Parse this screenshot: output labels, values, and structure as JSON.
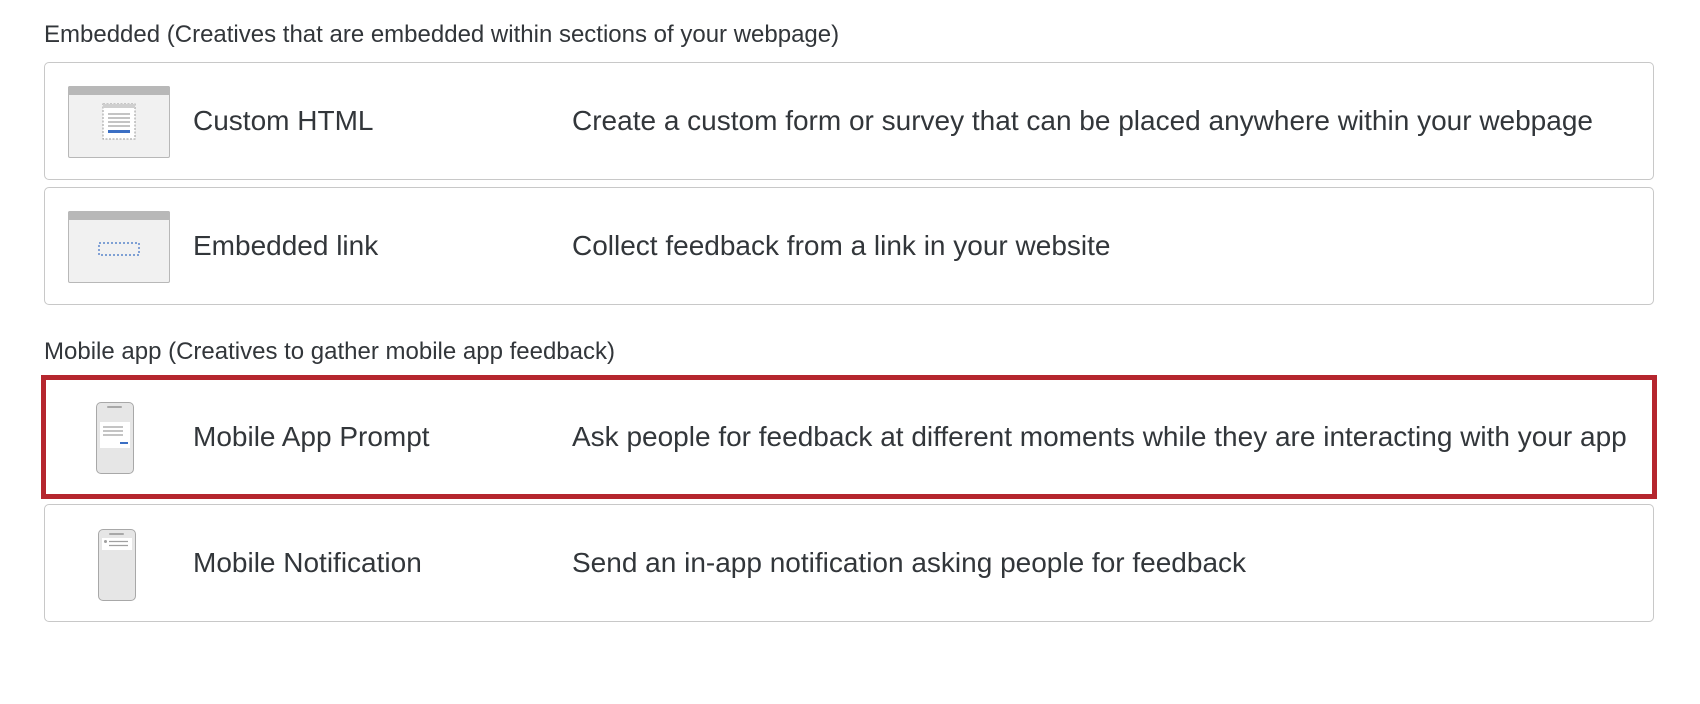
{
  "sections": {
    "embedded": {
      "heading": "Embedded (Creatives that are embedded within sections of your webpage)",
      "items": [
        {
          "title": "Custom HTML",
          "description": "Create a custom form or survey that can be placed anywhere within your webpage",
          "icon": "custom-html-icon"
        },
        {
          "title": "Embedded link",
          "description": "Collect feedback from a link in your website",
          "icon": "embedded-link-icon"
        }
      ]
    },
    "mobile": {
      "heading": "Mobile app (Creatives to gather mobile app feedback)",
      "items": [
        {
          "title": "Mobile App Prompt",
          "description": "Ask people for feedback at different moments while they are interacting with your app",
          "icon": "mobile-app-prompt-icon",
          "selected": true
        },
        {
          "title": "Mobile Notification",
          "description": "Send an in-app notification asking people for feedback",
          "icon": "mobile-notification-icon"
        }
      ]
    }
  },
  "colors": {
    "selected_border": "#b5262e",
    "card_border": "#c8c8c8",
    "text": "#32363a",
    "icon_accent": "#3b6fc4"
  }
}
